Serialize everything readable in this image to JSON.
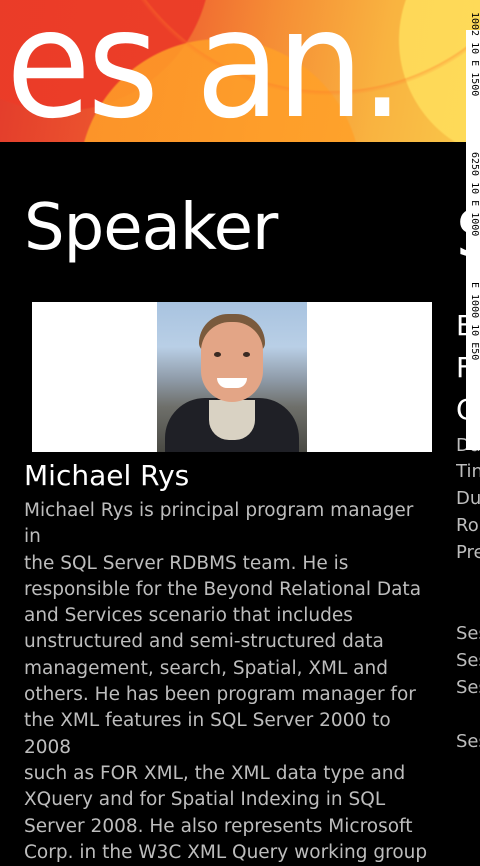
{
  "panorama": {
    "title": "es an."
  },
  "speaker_section": {
    "header": "Speaker",
    "photo_alt_icon": "speaker-photo",
    "name": "Michael Rys",
    "bio": "Michael Rys is principal program manager in\nthe SQL Server RDBMS team. He is\nresponsible for the Beyond Relational Data\nand Services scenario that includes\nunstructured and semi-structured data\nmanagement, search, Spatial, XML and\nothers. He has been program manager for\nthe XML features in SQL Server 2000 to 2008\nsuch as FOR XML, the XML data type and\nXQuery and for Spatial Indexing in SQL\nServer 2008. He also represents Microsoft\nCorp. in the W3C XML Query working group"
  },
  "next_section": {
    "title": "S",
    "heading_lines": [
      "E",
      "F",
      "Q"
    ],
    "labels": [
      "Da",
      "Tin",
      "Du",
      "Ro",
      "Pre",
      "Ses",
      "Ses",
      "Ses",
      "Ses"
    ]
  },
  "debug_strip": {
    "lines": [
      "1002 10 E 1500",
      "6250 10 E 1000",
      "E 1000 10 E50"
    ]
  }
}
